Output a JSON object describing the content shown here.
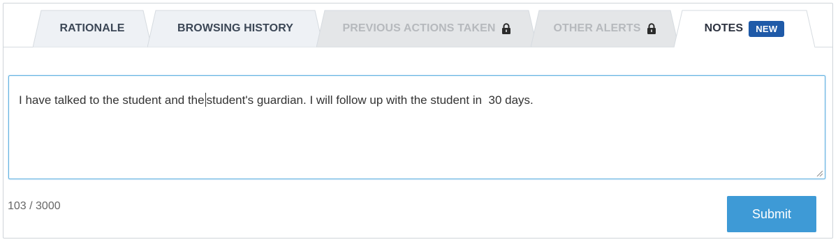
{
  "tabs": [
    {
      "label": "RATIONALE",
      "state": "normal",
      "locked": false
    },
    {
      "label": "BROWSING HISTORY",
      "state": "normal",
      "locked": false
    },
    {
      "label": "PREVIOUS ACTIONS TAKEN",
      "state": "disabled",
      "locked": true
    },
    {
      "label": "OTHER ALERTS",
      "state": "disabled",
      "locked": true
    },
    {
      "label": "NOTES",
      "state": "active",
      "locked": false,
      "badge": "NEW"
    }
  ],
  "notes": {
    "text_before_caret": "I have talked to the student and the",
    "text_after_caret": "student's guardian. I will follow up with the student in  30 days."
  },
  "counter": "103 / 3000",
  "submit_label": "Submit",
  "colors": {
    "accent": "#3e9ad6",
    "badge": "#1f5aa8",
    "tab_bg": "#eef1f5",
    "tab_disabled_bg": "#e4e6e8",
    "focus_border": "#5fb0e0"
  }
}
